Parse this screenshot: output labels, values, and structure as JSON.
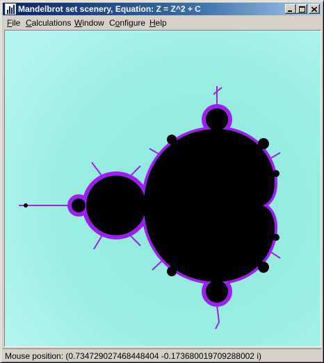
{
  "window": {
    "title": "Mandelbrot set scenery, Equation: Z = Z^2 + C"
  },
  "menu": [
    {
      "label": "File",
      "accel": "F"
    },
    {
      "label": "Calculations",
      "accel": "C"
    },
    {
      "label": "Window",
      "accel": "W"
    },
    {
      "label": "Configure",
      "accel": "o"
    },
    {
      "label": "Help",
      "accel": "H"
    }
  ],
  "status": {
    "text": "Mouse position: (0.734729027468448404 -0.173680019709288002 i)"
  },
  "colors": {
    "background": "#a8f0e6",
    "set": "#000000",
    "boundary": "#9b20f0",
    "title_active": "#0a246a"
  },
  "icons": [
    "app-icon",
    "minimize-icon",
    "maximize-icon",
    "close-icon"
  ]
}
